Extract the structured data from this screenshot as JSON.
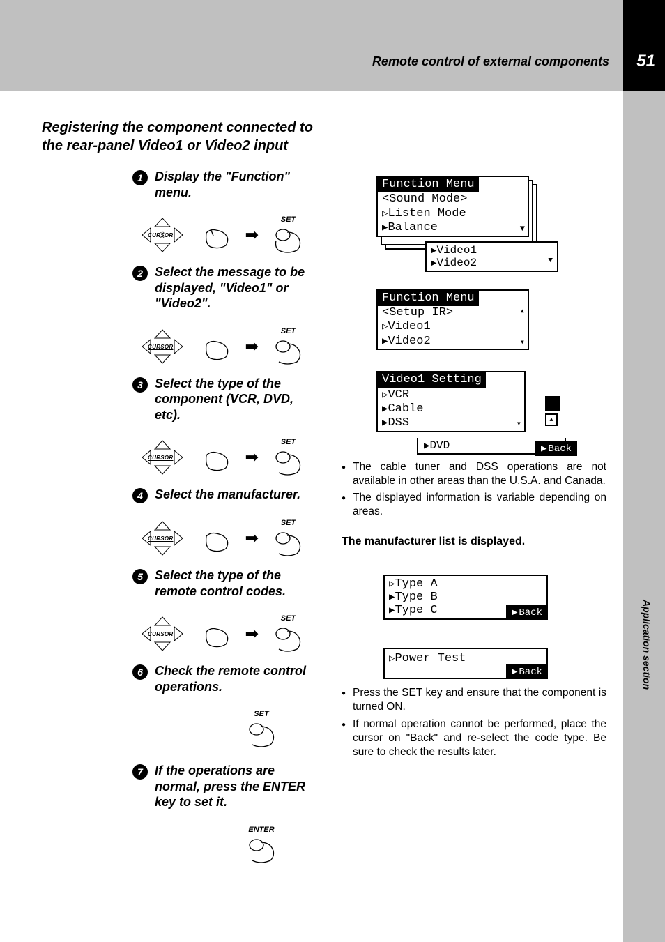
{
  "page": {
    "number": "51",
    "header": "Remote control of external components",
    "side_label": "Application section"
  },
  "title": "Registering the component connected to the rear-panel Video1 or Video2 input",
  "steps": {
    "s1": "Display the \"Function\" menu.",
    "s2": "Select the message to be displayed, \"Video1\" or \"Video2\".",
    "s3": "Select the type of the component (VCR, DVD, etc).",
    "s4": "Select the manufacturer.",
    "s5": "Select the type of the remote control codes.",
    "s6": "Check the remote control operations.",
    "s7": "If the operations are normal, press the ENTER key to set it."
  },
  "labels": {
    "cursor": "CURSOR",
    "set": "SET",
    "enter": "ENTER"
  },
  "lcd_top": {
    "title": "Function Menu",
    "line1": "<Sound Mode>",
    "line2": "Listen Mode",
    "line3": "Balance",
    "extra1": "Video1",
    "extra2": "Video2"
  },
  "lcd_setup": {
    "title": "Function Menu",
    "line1": "<Setup IR>",
    "line2": "Video1",
    "line3": "Video2"
  },
  "lcd_video": {
    "title": "Video1 Setting",
    "line1": "VCR",
    "line2": "Cable",
    "line3": "DSS",
    "sub": "DVD",
    "back": "Back"
  },
  "bullets1": {
    "b1": "The cable tuner and DSS operations are not available in other areas than the U.S.A. and Canada.",
    "b2": "The displayed information is variable depending on areas."
  },
  "subhead": "The manufacturer list is displayed.",
  "lcd_type": {
    "l1": "Type A",
    "l2": "Type B",
    "l3": "Type C",
    "back": "Back"
  },
  "lcd_power": {
    "l1": "Power Test",
    "back": "Back"
  },
  "bullets2": {
    "b1": "Press the SET key and ensure that the component is turned ON.",
    "b2": "If normal operation cannot be performed, place the cursor on \"Back\" and re-select the code type. Be sure to check the results later."
  }
}
